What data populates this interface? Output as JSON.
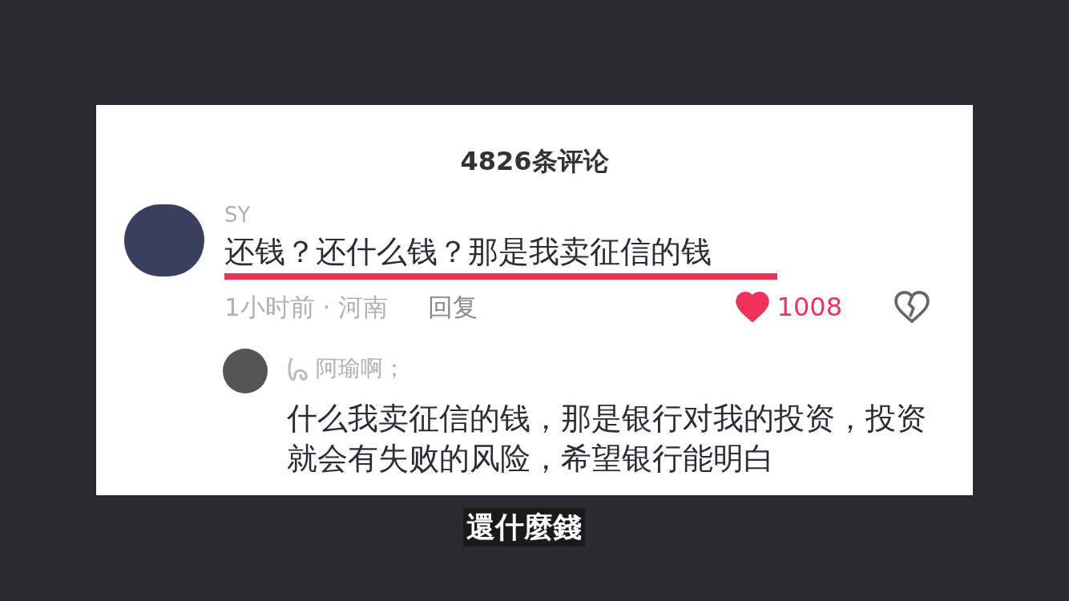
{
  "panel": {
    "title": "4826条评论"
  },
  "comment": {
    "author": "SY",
    "text": "还钱？还什么钱？那是我卖征信的钱",
    "highlighted": true,
    "time_location": "1小时前 · 河南",
    "reply_label": "回复",
    "liked": true,
    "likes": "1008"
  },
  "reply": {
    "author": "阿瑜啊；",
    "text": "什么我卖征信的钱，那是银行对我的投资，投资就会有失败的风险，希望银行能明白"
  },
  "subtitle": "還什麼錢"
}
